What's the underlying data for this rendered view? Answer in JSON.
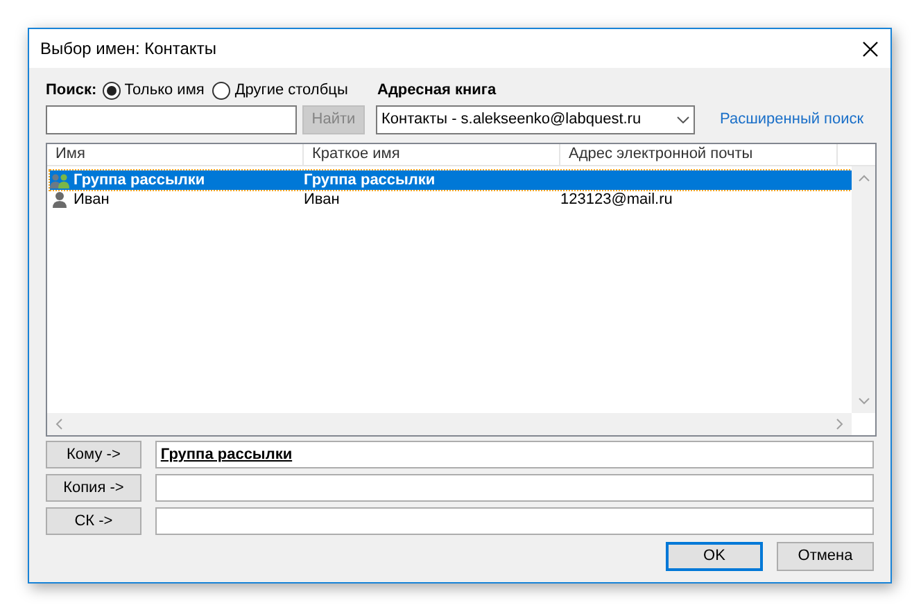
{
  "window": {
    "title": "Выбор имен: Контакты"
  },
  "search": {
    "label": "Поиск:",
    "options": [
      {
        "label": "Только имя",
        "selected": true
      },
      {
        "label": "Другие столбцы",
        "selected": false
      }
    ],
    "find_button": {
      "label": "Найти",
      "disabled": true
    }
  },
  "address_book": {
    "label": "Адресная книга",
    "value": "Контакты - s.alekseenko@labquest.ru"
  },
  "advanced_search": "Расширенный поиск",
  "table": {
    "columns": [
      "Имя",
      "Краткое имя",
      "Адрес электронной почты"
    ],
    "rows": [
      {
        "kind": "group",
        "name": "Группа рассылки",
        "short_name": "Группа рассылки",
        "selected": true
      },
      {
        "kind": "person",
        "name": "Иван",
        "short_name": "Иван",
        "email": "123123@mail.ru",
        "selected": false
      }
    ]
  },
  "recipients": [
    {
      "button": "Кому ->",
      "value": "Группа рассылки"
    },
    {
      "button": "Копия ->"
    },
    {
      "button": "СК ->"
    }
  ],
  "buttons": [
    {
      "label": "OK",
      "default": true
    },
    {
      "label": "Отмена",
      "default": false
    }
  ]
}
